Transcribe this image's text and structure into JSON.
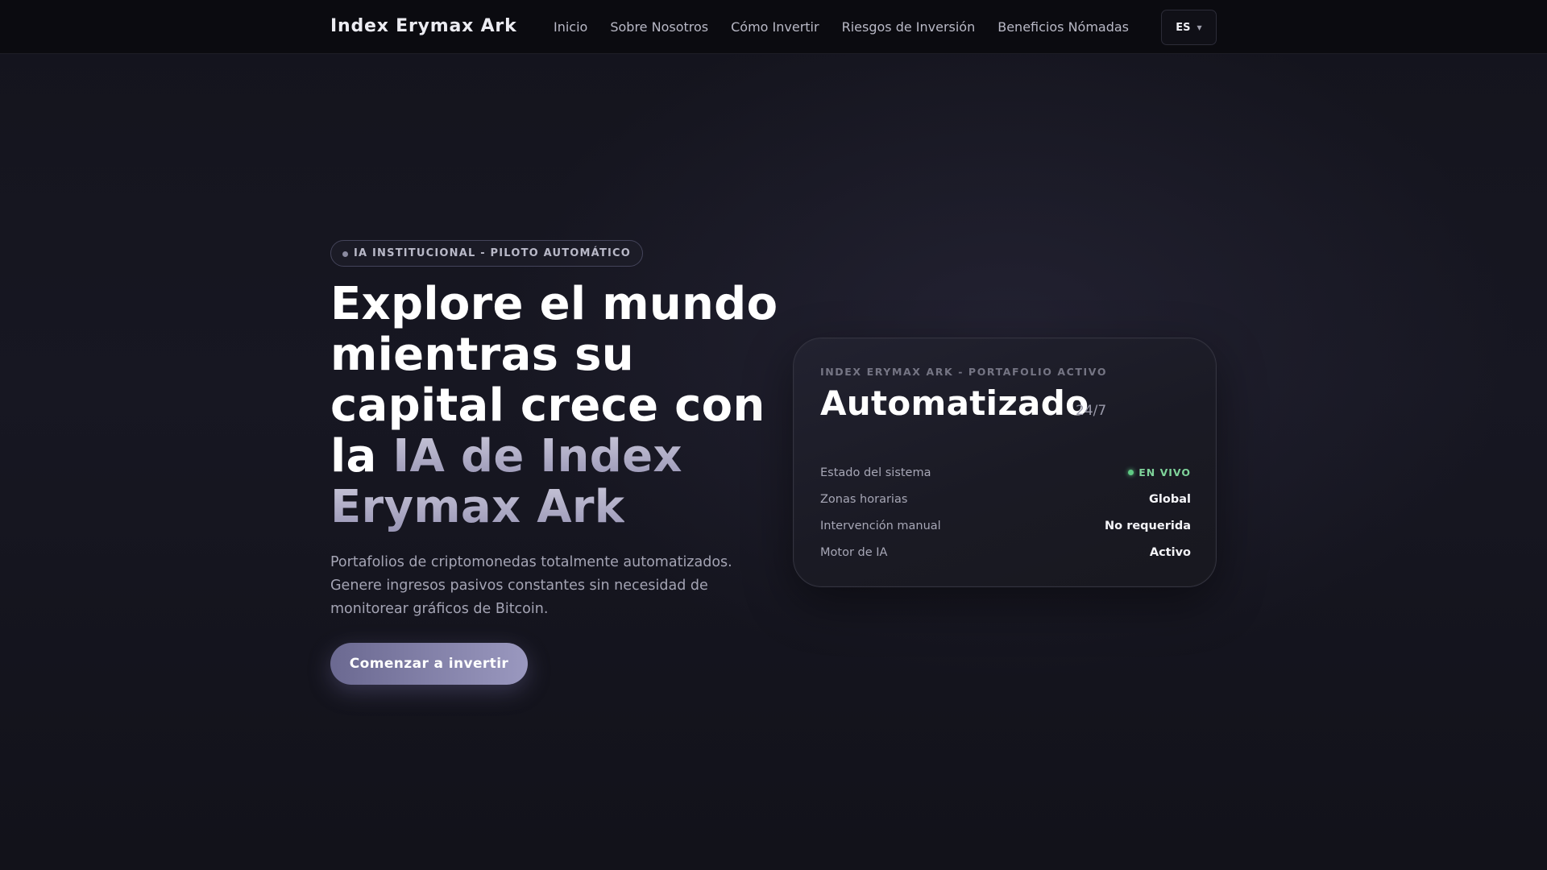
{
  "nav": {
    "brand": "Index Erymax Ark",
    "links": [
      "Inicio",
      "Sobre Nosotros",
      "Cómo Invertir",
      "Riesgos de Inversión",
      "Beneficios Nómadas"
    ],
    "language": "ES"
  },
  "hero": {
    "badge": "IA INSTITUCIONAL - PILOTO AUTOMÁTICO",
    "headline_plain": "Explore el mundo mientras su capital crece con la ",
    "headline_highlight": "IA de Index Erymax Ark",
    "subtitle": "Portafolios de criptomonedas totalmente automatizados. Genere ingresos pasivos constantes sin necesidad de monitorear gráficos de Bitcoin.",
    "cta": "Comenzar a invertir"
  },
  "card": {
    "label": "INDEX ERYMAX ARK - PORTAFOLIO ACTIVO",
    "title": "Automatizado",
    "suffix": "24/7",
    "rows": [
      {
        "label": "Estado del sistema",
        "value": "EN VIVO"
      },
      {
        "label": "Zonas horarias",
        "value": "Global"
      },
      {
        "label": "Intervención manual",
        "value": "No requerida"
      },
      {
        "label": "Motor de IA",
        "value": "Activo"
      }
    ]
  },
  "colors": {
    "accent": "#9a98bf",
    "live": "#7fd39a"
  }
}
